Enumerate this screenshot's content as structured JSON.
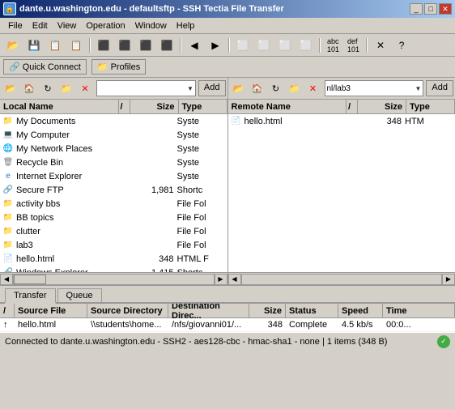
{
  "window": {
    "title": "dante.u.washington.edu - defaultsftp - SSH Tectia File Transfer",
    "icon": "🔒"
  },
  "menu": {
    "items": [
      "File",
      "Edit",
      "View",
      "Operation",
      "Window",
      "Help"
    ]
  },
  "quickconnect": {
    "label": "Quick Connect",
    "profiles_label": "Profiles"
  },
  "left_pane": {
    "title": "Local Name",
    "cols": [
      "/",
      "Size",
      "Type"
    ],
    "items": [
      {
        "name": "My Documents",
        "size": "",
        "type": "Syste",
        "icon": "folder"
      },
      {
        "name": "My Computer",
        "size": "",
        "type": "Syste",
        "icon": "computer"
      },
      {
        "name": "My Network Places",
        "size": "",
        "type": "Syste",
        "icon": "network"
      },
      {
        "name": "Recycle Bin",
        "size": "",
        "type": "Syste",
        "icon": "recycle"
      },
      {
        "name": "Internet Explorer",
        "size": "",
        "type": "Syste",
        "icon": "ie"
      },
      {
        "name": "Secure FTP",
        "size": "1,981",
        "type": "Shortc",
        "icon": "shortcut"
      },
      {
        "name": "activity bbs",
        "size": "",
        "type": "File Fo",
        "icon": "folder"
      },
      {
        "name": "BB topics",
        "size": "",
        "type": "File Fo",
        "icon": "folder"
      },
      {
        "name": "clutter",
        "size": "",
        "type": "File Fo",
        "icon": "folder"
      },
      {
        "name": "lab3",
        "size": "",
        "type": "File Fo",
        "icon": "folder"
      },
      {
        "name": "hello.html",
        "size": "348",
        "type": "HTML F",
        "icon": "html"
      },
      {
        "name": "Windows Explorer",
        "size": "1,415",
        "type": "Shortc",
        "icon": "shortcut"
      }
    ]
  },
  "right_pane": {
    "title": "Remote Name",
    "cols": [
      "/",
      "Size",
      "Type"
    ],
    "path": "nl/lab3",
    "items": [
      {
        "name": "hello.html",
        "size": "348",
        "type": "HTM",
        "icon": "html"
      }
    ]
  },
  "tabs": [
    "Transfer",
    "Queue"
  ],
  "transfer_table": {
    "cols": [
      "/",
      "Source File",
      "Source Directory",
      "Destination Direc...",
      "Size",
      "Status",
      "Speed",
      "Time"
    ],
    "rows": [
      {
        "arrow": "↑",
        "source_file": "hello.html",
        "source_dir": "\\\\students\\home...",
        "dest_dir": "/nfs/giovanni01/...",
        "size": "348",
        "status": "Complete",
        "speed": "4.5 kb/s",
        "time": "00:0..."
      }
    ]
  },
  "status_bar": {
    "text": "Connected to dante.u.washington.edu - SSH2 - aes128-cbc - hmac-sha1 - none | 1 items (348 B)"
  },
  "toolbar_icons": {
    "back": "◀",
    "forward": "▶",
    "up": "↑",
    "new_folder": "📁",
    "delete": "✕",
    "refresh": "↻",
    "properties": "ℹ",
    "add": "Add"
  }
}
